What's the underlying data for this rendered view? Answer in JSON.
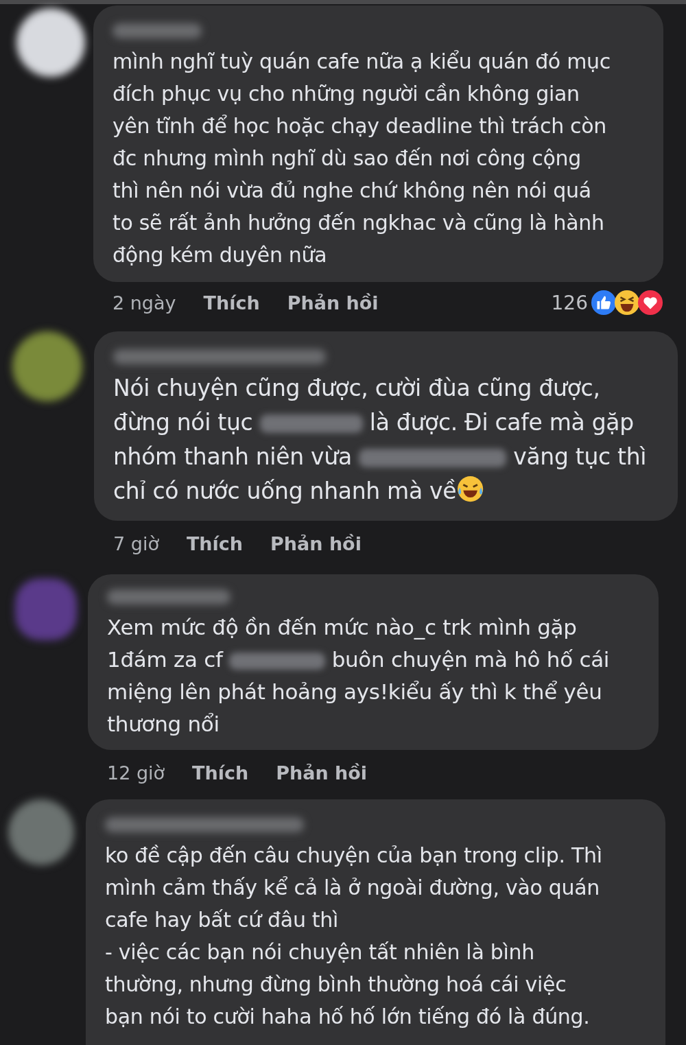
{
  "comments": [
    {
      "lines": [
        [
          {
            "kind": "text",
            "text": "mình nghĩ tuỳ quán cafe nữa ạ kiểu quán đó mục"
          }
        ],
        [
          {
            "kind": "text",
            "text": "đích phục vụ cho những người cần không gian"
          }
        ],
        [
          {
            "kind": "text",
            "text": "yên tĩnh để học hoặc chạy deadline thì trách còn"
          }
        ],
        [
          {
            "kind": "text",
            "text": "đc nhưng mình nghĩ dù sao đến nơi công cộng"
          }
        ],
        [
          {
            "kind": "text",
            "text": "thì nên nói vừa đủ nghe chứ không nên nói quá"
          }
        ],
        [
          {
            "kind": "text",
            "text": "to sẽ rất ảnh hưởng đến ngkhac và cũng là hành"
          }
        ],
        [
          {
            "kind": "text",
            "text": "động kém duyên nữa"
          }
        ]
      ],
      "time": "2 ngày",
      "like": "Thích",
      "reply": "Phản hồi",
      "reaction_count": "126"
    },
    {
      "lines": [
        [
          {
            "kind": "text",
            "text": "Nói chuyện cũng được, cười đùa cũng được,"
          }
        ],
        [
          {
            "kind": "text",
            "text": "đừng nói tục "
          },
          {
            "kind": "redacted"
          },
          {
            "kind": "text",
            "text": " là được. Đi cafe mà gặp"
          }
        ],
        [
          {
            "kind": "text",
            "text": "nhóm thanh niên vừa "
          },
          {
            "kind": "redacted"
          },
          {
            "kind": "text",
            "text": " văng tục thì"
          }
        ],
        [
          {
            "kind": "text",
            "text": "chỉ có nước uống nhanh mà về"
          },
          {
            "kind": "emoji"
          }
        ]
      ],
      "time": "7 giờ",
      "like": "Thích",
      "reply": "Phản hồi"
    },
    {
      "lines": [
        [
          {
            "kind": "text",
            "text": "Xem mức độ ồn đến mức nào_c trk mình gặp"
          }
        ],
        [
          {
            "kind": "text",
            "text": "1đám za cf "
          },
          {
            "kind": "redacted"
          },
          {
            "kind": "text",
            "text": " buôn chuyện mà hô hố cái"
          }
        ],
        [
          {
            "kind": "text",
            "text": "miệng lên phát hoảng ays!kiểu ấy thì k thể yêu"
          }
        ],
        [
          {
            "kind": "text",
            "text": "thương nổi"
          }
        ]
      ],
      "time": "12 giờ",
      "like": "Thích",
      "reply": "Phản hồi"
    },
    {
      "lines": [
        [
          {
            "kind": "text",
            "text": "ko đề cập đến câu chuyện của bạn trong clip. Thì"
          }
        ],
        [
          {
            "kind": "text",
            "text": "mình cảm thấy kể cả là ở ngoài đường, vào quán"
          }
        ],
        [
          {
            "kind": "text",
            "text": "cafe hay bất cứ đâu thì"
          }
        ],
        [
          {
            "kind": "text",
            "text": "- việc các bạn nói chuyện tất nhiên là bình"
          }
        ],
        [
          {
            "kind": "text",
            "text": "thường, nhưng đừng bình thường hoá cái việc"
          }
        ],
        [
          {
            "kind": "text",
            "text": "bạn nói to cười haha hố hố lớn tiếng đó là đúng."
          }
        ]
      ]
    }
  ]
}
